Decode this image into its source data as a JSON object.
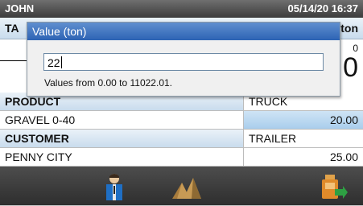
{
  "topbar": {
    "operator": "JOHN",
    "datetime": "05/14/20 16:37"
  },
  "header": {
    "left_label": "TA",
    "right_label": "ton"
  },
  "weight": {
    "small_value": "0",
    "big_value": "0"
  },
  "rows": {
    "product_label": "PRODUCT",
    "product_value": "GRAVEL 0-40",
    "truck_label": "TRUCK",
    "truck_value": "20.00",
    "customer_label": "CUSTOMER",
    "customer_value": "PENNY CITY",
    "trailer_label": "TRAILER",
    "trailer_value": "25.00"
  },
  "dialog": {
    "title": "Value (ton)",
    "input_value": "22",
    "hint": "Values from 0.00 to 11022.01."
  },
  "bottombar": {
    "icons": [
      "driver-icon",
      "material-pile-icon",
      "exit-device-icon"
    ]
  },
  "colors": {
    "title_blue": "#2d63b4",
    "row_blue": "#a9cdec",
    "bar_dark": "#3c3c3c"
  }
}
